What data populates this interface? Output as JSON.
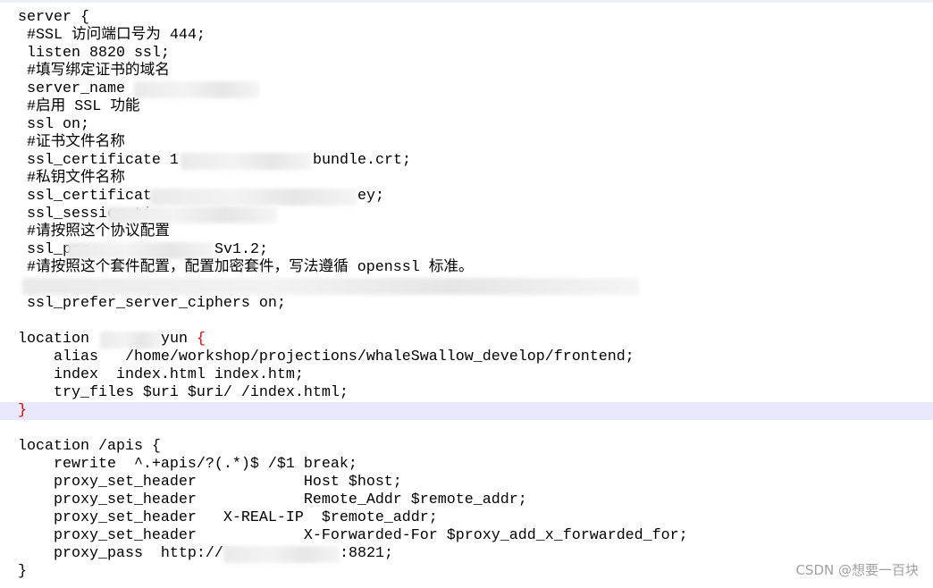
{
  "lines": [
    "server {",
    " #SSL 访问端口号为 444;",
    " listen 8820 ssl;",
    " #填写绑定证书的域名",
    " server_name ",
    " #启用 SSL 功能",
    " ssl on;",
    " #证书文件名称",
    " ssl_certificate 1",
    " #私钥文件名称",
    " ssl_certificat",
    " ssl_session_ti",
    " #请按照这个协议配置",
    " ssl_pro",
    " #请按照这个套件配置，配置加密套件，写法遵循 openssl 标准。",
    "",
    " ssl_prefer_server_ciphers on;",
    "",
    "location ",
    "    alias   /home/workshop/projections/whaleSwallow_develop/frontend;",
    "    index  index.html index.htm;",
    "    try_files $uri $uri/ /index.html;",
    "}",
    "",
    "location /apis {",
    "    rewrite  ^.+apis/?(.*)$ /$1 break;",
    "    proxy_set_header            Host $host;",
    "    proxy_set_header            Remote_Addr $remote_addr;",
    "    proxy_set_header   X-REAL-IP  $remote_addr;",
    "    proxy_set_header            X-Forwarded-For $proxy_add_x_forwarded_for;",
    "    proxy_pass  http://",
    "}"
  ],
  "tails": {
    "cert": "bundle.crt;",
    "key": "ey;",
    "protocols": "Sv1.2;",
    "location_yun": "yun ",
    "brace": "{",
    "proxy_port": ":8821;"
  },
  "watermark": "CSDN @想要一百块",
  "colors": {
    "highlight_line": "#e8e8fa",
    "brace_match": "#e00000"
  }
}
